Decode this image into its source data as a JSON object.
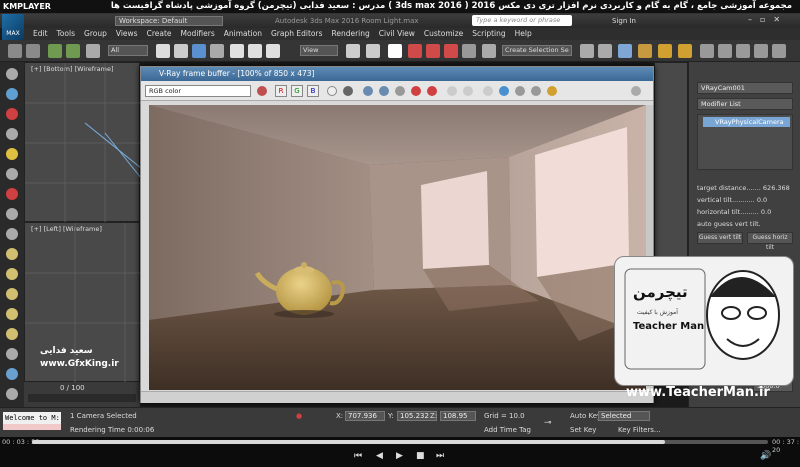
{
  "player": {
    "brand": "KMPLAYER",
    "course_title": "مجموعه آموزشی جامع ، گام به گام و کاربردی نرم افزار تری دی مکس 2016 ( 3ds max 2016 ) مدرس : سعید فدایی (تیچرمن) گروه آموزشی پادشاه گرافیست ها",
    "time_current": "00 : 03 : 55",
    "time_total": "00 : 37 : 20",
    "progress": 0.86
  },
  "titlebar": {
    "app_logo": "MAX",
    "workspace": "Workspace: Default",
    "app_name": "Autodesk 3ds Max 2016    Room Light.max",
    "search_placeholder": "Type a keyword or phrase",
    "sign_in": "Sign In"
  },
  "menu": [
    "Edit",
    "Tools",
    "Group",
    "Views",
    "Create",
    "Modifiers",
    "Animation",
    "Graph Editors",
    "Rendering",
    "Civil View",
    "Customize",
    "Scripting",
    "Help"
  ],
  "toolbar": {
    "filter": "All",
    "ref_coord": "View",
    "selection_set": "Create Selection Se"
  },
  "viewports": {
    "top_label": "[+] [Bottom] [Wireframe]",
    "left_label": "[+] [Left] [Wireframe]"
  },
  "vfb": {
    "title": "V-Ray frame buffer - [100% of 850 x 473]",
    "channel": "RGB color",
    "channels": [
      "R",
      "G",
      "B"
    ]
  },
  "command_panel": {
    "object_name": "VRayCam001",
    "modifier_list": "Modifier List",
    "modifier_item": "VRayPhysicalCamera",
    "target_distance_label": "target distance.......",
    "target_distance": "626.368",
    "vertical_tilt_label": "vertical tilt...........",
    "vertical_tilt": "0.0",
    "horizontal_tilt_label": "horizontal tilt.........",
    "horizontal_tilt": "0.0",
    "auto_guess_label": "auto guess vert tilt.",
    "guess_vert": "Guess vert tilt",
    "guess_horiz": "Guess horiz tilt",
    "bottom_value": "1000.0"
  },
  "status": {
    "welcome": "Welcome to M:",
    "timeline": "0 / 100",
    "selection": "1 Camera Selected",
    "rendering_time": "Rendering Time  0:00:06",
    "x_label": "X:",
    "x": "707.936",
    "y_label": "Y:",
    "y": "105.232",
    "z_label": "Z:",
    "z": "108.95",
    "grid": "Grid = 10.0",
    "add_time_tag": "Add Time Tag",
    "auto_key": "Auto Key",
    "selected": "Selected",
    "set_key": "Set Key",
    "key_filters": "Key Filters..."
  },
  "watermarks": {
    "teacherman_fa": "تیچرمن",
    "teacherman_sub": "آموزش با کیفیت",
    "teacherman_en": "Teacher Man",
    "site": "www.TeacherMan.ir",
    "gfx_fa": "سعید فدایی",
    "gfx_site": "www.GfxKing.ir"
  }
}
